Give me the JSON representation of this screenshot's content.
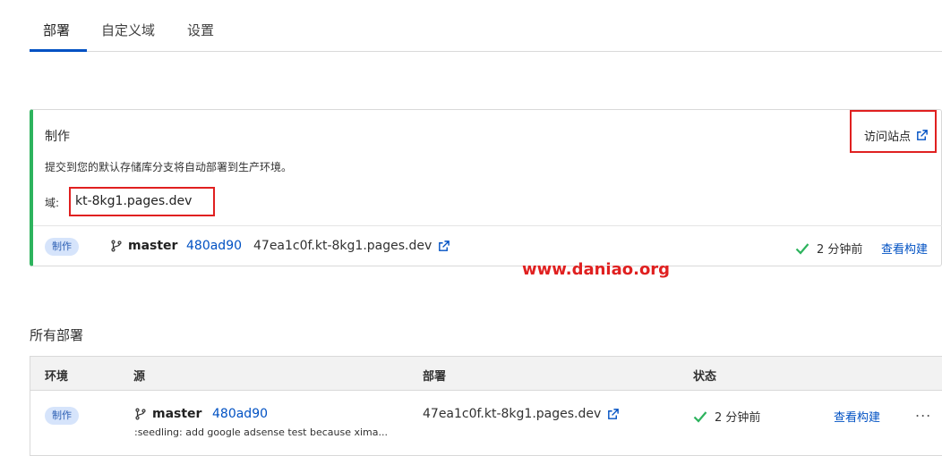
{
  "tabs": [
    {
      "label": "部署"
    },
    {
      "label": "自定义域"
    },
    {
      "label": "设置"
    }
  ],
  "production": {
    "title": "制作",
    "visit_label": "访问站点",
    "description": "提交到您的默认存储库分支将自动部署到生产环境。",
    "domain_label": "域:",
    "domain_value": "kt-8kg1.pages.dev",
    "badge": "制作",
    "branch": "master",
    "commit": "480ad90",
    "deploy_url": "47ea1c0f.kt-8kg1.pages.dev",
    "status": "2 分钟前",
    "view_build": "查看构建"
  },
  "watermark": "www.daniao.org",
  "all_deployments": {
    "title": "所有部署",
    "columns": [
      "环境",
      "源",
      "部署",
      "状态"
    ],
    "rows": [
      {
        "env": "制作",
        "branch": "master",
        "commit": "480ad90",
        "commit_message": ":seedling: add google adsense test because xima...",
        "deploy_url": "47ea1c0f.kt-8kg1.pages.dev",
        "status": "2 分钟前",
        "view_build": "查看构建",
        "more": "..."
      }
    ]
  },
  "colors": {
    "accent": "#0051c3",
    "success": "#2db35d",
    "highlight": "#e02020",
    "badge_bg": "#d6e4fb"
  },
  "icons": [
    "external-link-icon",
    "branch-icon",
    "check-icon",
    "more-icon"
  ]
}
